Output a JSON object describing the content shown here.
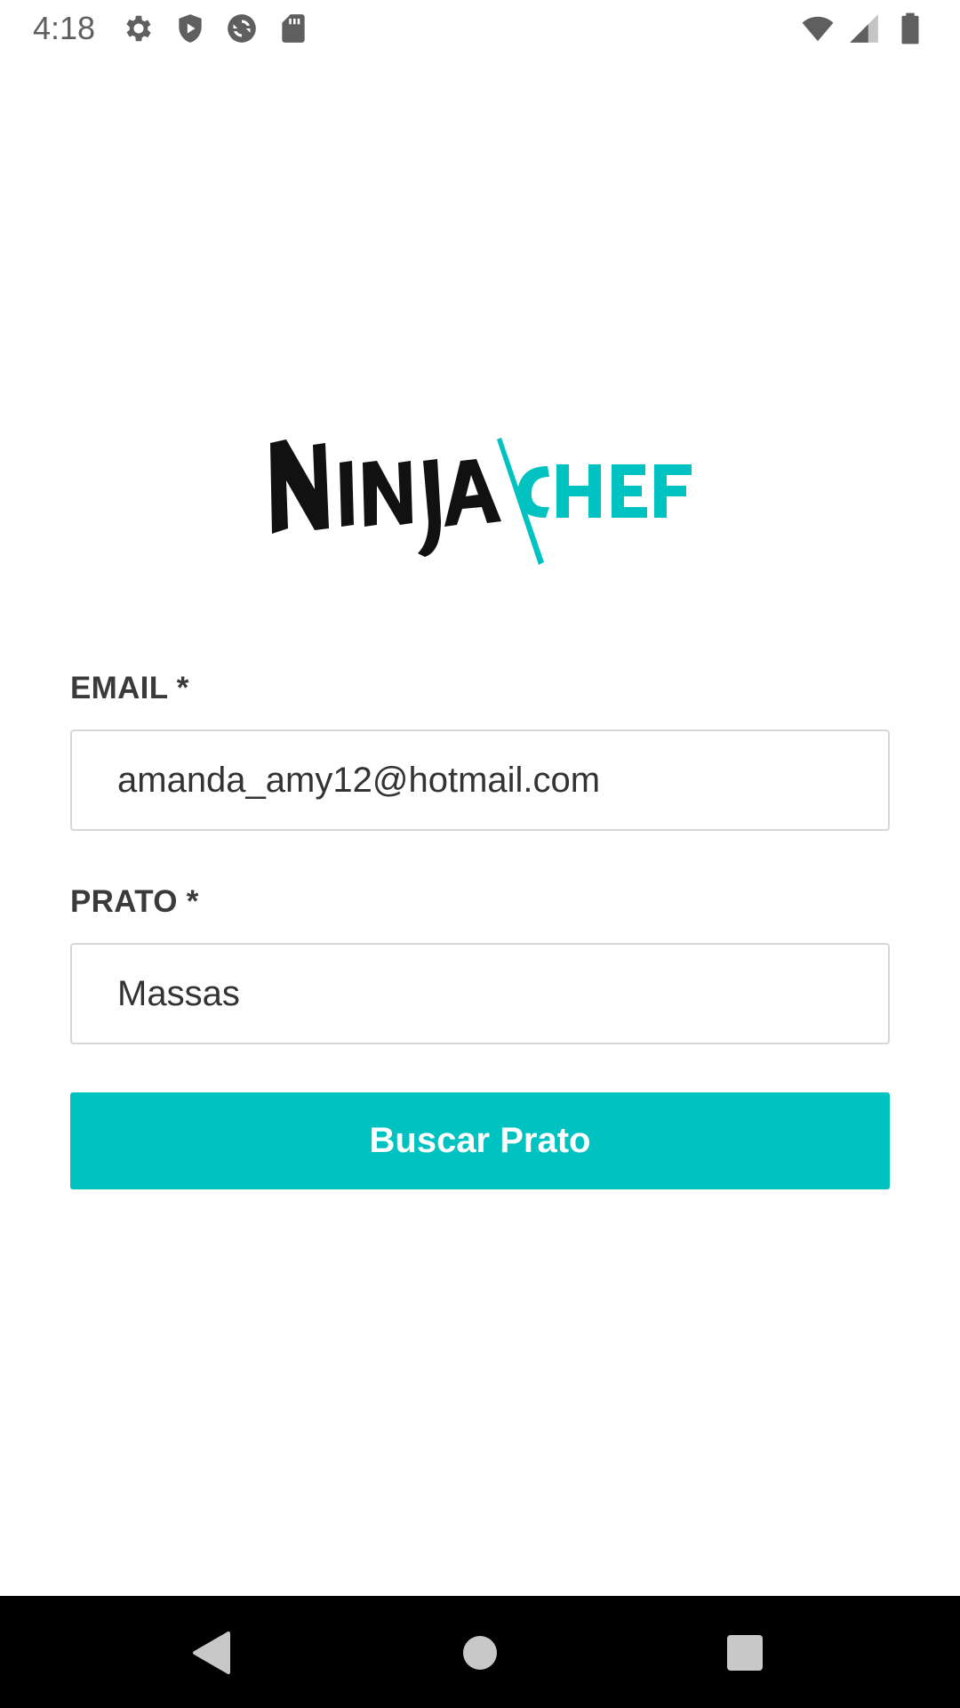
{
  "status_bar": {
    "time": "4:18",
    "left_icons": [
      "settings-icon",
      "shield-icon",
      "sync-icon",
      "sd-card-icon"
    ],
    "right_icons": [
      "wifi-icon",
      "cell-signal-icon",
      "battery-icon"
    ]
  },
  "logo": {
    "text_dark": "NINJA",
    "text_accent": "CHEF",
    "accent_color": "#00c2c0"
  },
  "form": {
    "email_label": "EMAIL *",
    "email_value": "amanda_amy12@hotmail.com",
    "prato_label": "PRATO *",
    "prato_value": "Massas",
    "submit_label": "Buscar Prato",
    "button_color": "#00c2c0"
  },
  "nav_bar": {
    "buttons": [
      "back-icon",
      "home-icon",
      "recents-icon"
    ]
  }
}
